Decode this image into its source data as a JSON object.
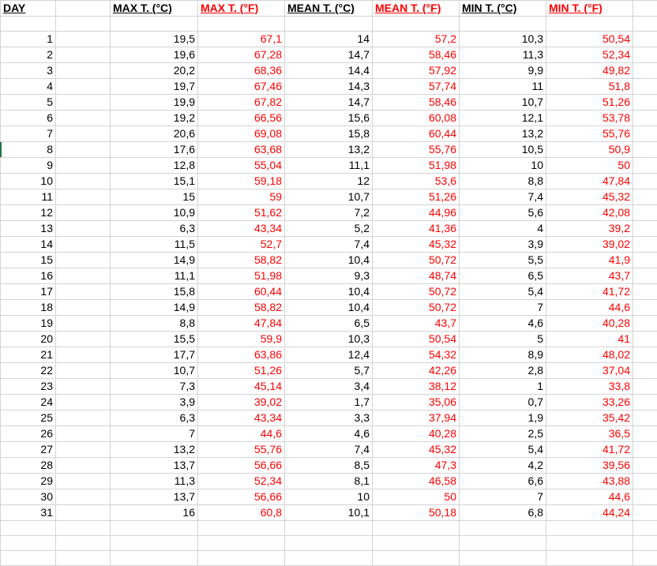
{
  "headers": {
    "day": "DAY",
    "max_c": "MAX T. (°C)",
    "max_f": "MAX T. (°F)",
    "mean_c": "MEAN T. (°C)",
    "mean_f": "MEAN T. (°F)",
    "min_c": "MIN T. (°C)",
    "min_f": "MIN T. (°F)"
  },
  "colors": {
    "fahrenheit": "#ff0000",
    "celsius": "#000000",
    "gridline": "#d4d4d4",
    "row_marker": "#217346"
  },
  "rows": [
    [
      "1",
      "19,5",
      "67,1",
      "14",
      "57,2",
      "10,3",
      "50,54"
    ],
    [
      "2",
      "19,6",
      "67,28",
      "14,7",
      "58,46",
      "11,3",
      "52,34"
    ],
    [
      "3",
      "20,2",
      "68,36",
      "14,4",
      "57,92",
      "9,9",
      "49,82"
    ],
    [
      "4",
      "19,7",
      "67,46",
      "14,3",
      "57,74",
      "11",
      "51,8"
    ],
    [
      "5",
      "19,9",
      "67,82",
      "14,7",
      "58,46",
      "10,7",
      "51,26"
    ],
    [
      "6",
      "19,2",
      "66,56",
      "15,6",
      "60,08",
      "12,1",
      "53,78"
    ],
    [
      "7",
      "20,6",
      "69,08",
      "15,8",
      "60,44",
      "13,2",
      "55,76"
    ],
    [
      "8",
      "17,6",
      "63,68",
      "13,2",
      "55,76",
      "10,5",
      "50,9"
    ],
    [
      "9",
      "12,8",
      "55,04",
      "11,1",
      "51,98",
      "10",
      "50"
    ],
    [
      "10",
      "15,1",
      "59,18",
      "12",
      "53,6",
      "8,8",
      "47,84"
    ],
    [
      "11",
      "15",
      "59",
      "10,7",
      "51,26",
      "7,4",
      "45,32"
    ],
    [
      "12",
      "10,9",
      "51,62",
      "7,2",
      "44,96",
      "5,6",
      "42,08"
    ],
    [
      "13",
      "6,3",
      "43,34",
      "5,2",
      "41,36",
      "4",
      "39,2"
    ],
    [
      "14",
      "11,5",
      "52,7",
      "7,4",
      "45,32",
      "3,9",
      "39,02"
    ],
    [
      "15",
      "14,9",
      "58,82",
      "10,4",
      "50,72",
      "5,5",
      "41,9"
    ],
    [
      "16",
      "11,1",
      "51,98",
      "9,3",
      "48,74",
      "6,5",
      "43,7"
    ],
    [
      "17",
      "15,8",
      "60,44",
      "10,4",
      "50,72",
      "5,4",
      "41,72"
    ],
    [
      "18",
      "14,9",
      "58,82",
      "10,4",
      "50,72",
      "7",
      "44,6"
    ],
    [
      "19",
      "8,8",
      "47,84",
      "6,5",
      "43,7",
      "4,6",
      "40,28"
    ],
    [
      "20",
      "15,5",
      "59,9",
      "10,3",
      "50,54",
      "5",
      "41"
    ],
    [
      "21",
      "17,7",
      "63,86",
      "12,4",
      "54,32",
      "8,9",
      "48,02"
    ],
    [
      "22",
      "10,7",
      "51,26",
      "5,7",
      "42,26",
      "2,8",
      "37,04"
    ],
    [
      "23",
      "7,3",
      "45,14",
      "3,4",
      "38,12",
      "1",
      "33,8"
    ],
    [
      "24",
      "3,9",
      "39,02",
      "1,7",
      "35,06",
      "0,7",
      "33,26"
    ],
    [
      "25",
      "6,3",
      "43,34",
      "3,3",
      "37,94",
      "1,9",
      "35,42"
    ],
    [
      "26",
      "7",
      "44,6",
      "4,6",
      "40,28",
      "2,5",
      "36,5"
    ],
    [
      "27",
      "13,2",
      "55,76",
      "7,4",
      "45,32",
      "5,4",
      "41,72"
    ],
    [
      "28",
      "13,7",
      "56,66",
      "8,5",
      "47,3",
      "4,2",
      "39,56"
    ],
    [
      "29",
      "11,3",
      "52,34",
      "8,1",
      "46,58",
      "6,6",
      "43,88"
    ],
    [
      "30",
      "13,7",
      "56,66",
      "10",
      "50",
      "7",
      "44,6"
    ],
    [
      "31",
      "16",
      "60,8",
      "10,1",
      "50,18",
      "6,8",
      "44,24"
    ]
  ]
}
